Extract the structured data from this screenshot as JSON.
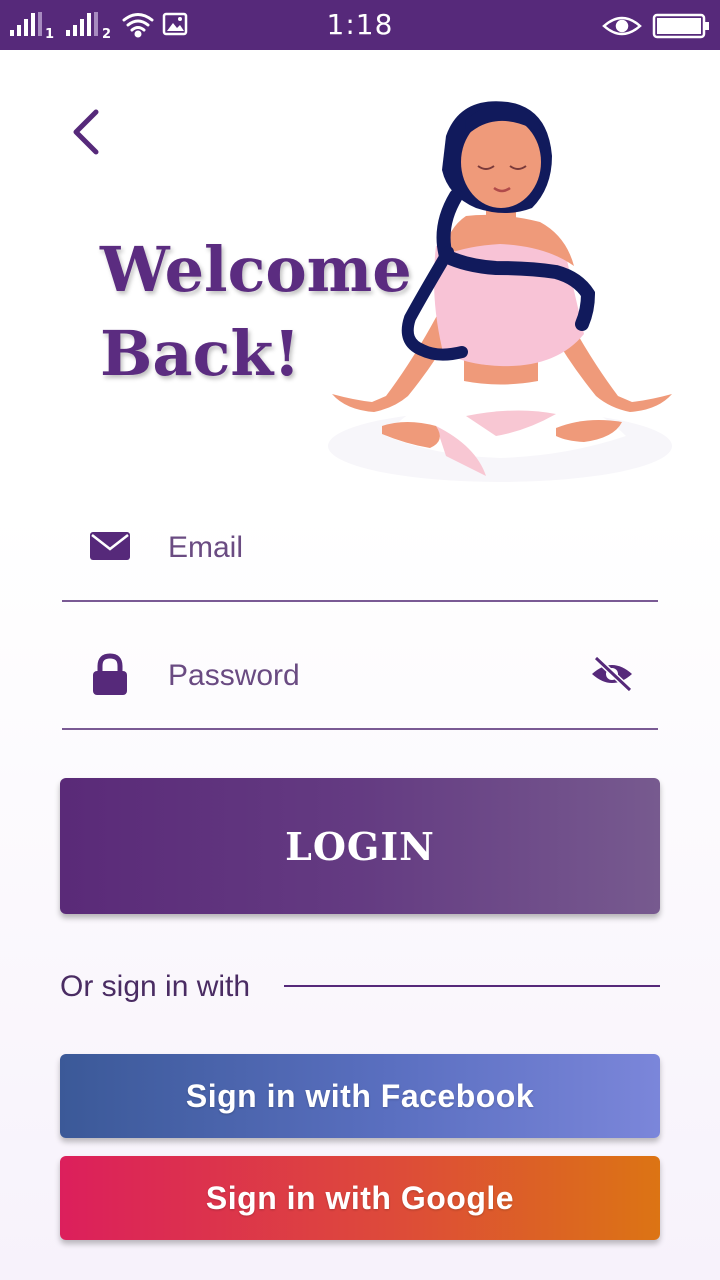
{
  "status_bar": {
    "time": "1:18",
    "sim1": "1",
    "sim2": "2",
    "icons": [
      "signal-sim1-icon",
      "signal-sim2-icon",
      "wifi-icon",
      "image-icon",
      "eye-icon",
      "battery-icon"
    ]
  },
  "header": {
    "title_line1": "Welcome",
    "title_line2": "Back!",
    "illustration": "meditating-woman-illustration"
  },
  "form": {
    "email": {
      "placeholder": "Email",
      "value": "",
      "icon": "envelope-icon"
    },
    "password": {
      "placeholder": "Password",
      "value": "",
      "icon": "lock-icon",
      "toggle_icon": "eye-off-icon"
    },
    "login_label": "LOGIN"
  },
  "social": {
    "or_label": "Or sign in with",
    "facebook_label": "Sign in with Facebook",
    "google_label": "Sign in with Google"
  },
  "colors": {
    "primary": "#56297a",
    "accent_text": "#5b2c80",
    "facebook_start": "#3b5998",
    "facebook_end": "#7b86da",
    "google_start": "#dc1f5c",
    "google_end": "#dc7414"
  }
}
